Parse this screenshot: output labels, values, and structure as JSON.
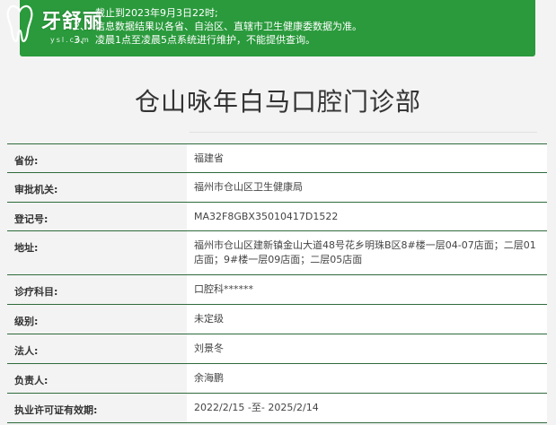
{
  "notice": {
    "lines": [
      {
        "num": "",
        "text": "截止到2023年9月3日22时;"
      },
      {
        "num": "2、",
        "text": "信息数据结果以各省、自治区、直辖市卫生健康委数据为准。"
      },
      {
        "num": "3、",
        "text": "凌晨1点至凌晨5点系统进行维护，不能提供查询。"
      }
    ]
  },
  "logo": {
    "brand": "牙舒丽",
    "sub": "ysl.com"
  },
  "page_title": "仓山咏年白马口腔门诊部",
  "rows": [
    {
      "label": "省份:",
      "value": "福建省"
    },
    {
      "label": "审批机关:",
      "value": "福州市仓山区卫生健康局"
    },
    {
      "label": "登记号:",
      "value": "MA32F8GBX35010417D1522"
    },
    {
      "label": "地址:",
      "value": "福州市仓山区建新镇金山大道48号花乡明珠B区8#楼一层04-07店面；二层01店面；9#楼一层09店面；二层05店面"
    },
    {
      "label": "诊疗科目:",
      "value": "口腔科******"
    },
    {
      "label": "级别:",
      "value": "未定级"
    },
    {
      "label": "法人:",
      "value": "刘景冬"
    },
    {
      "label": "负责人:",
      "value": "余海鹏"
    },
    {
      "label": "执业许可证有效期:",
      "value": "2022/2/15 -至- 2025/2/14"
    }
  ],
  "colors": {
    "notice_bg": "#2a9a3c",
    "row_border": "#2f6b3c"
  }
}
